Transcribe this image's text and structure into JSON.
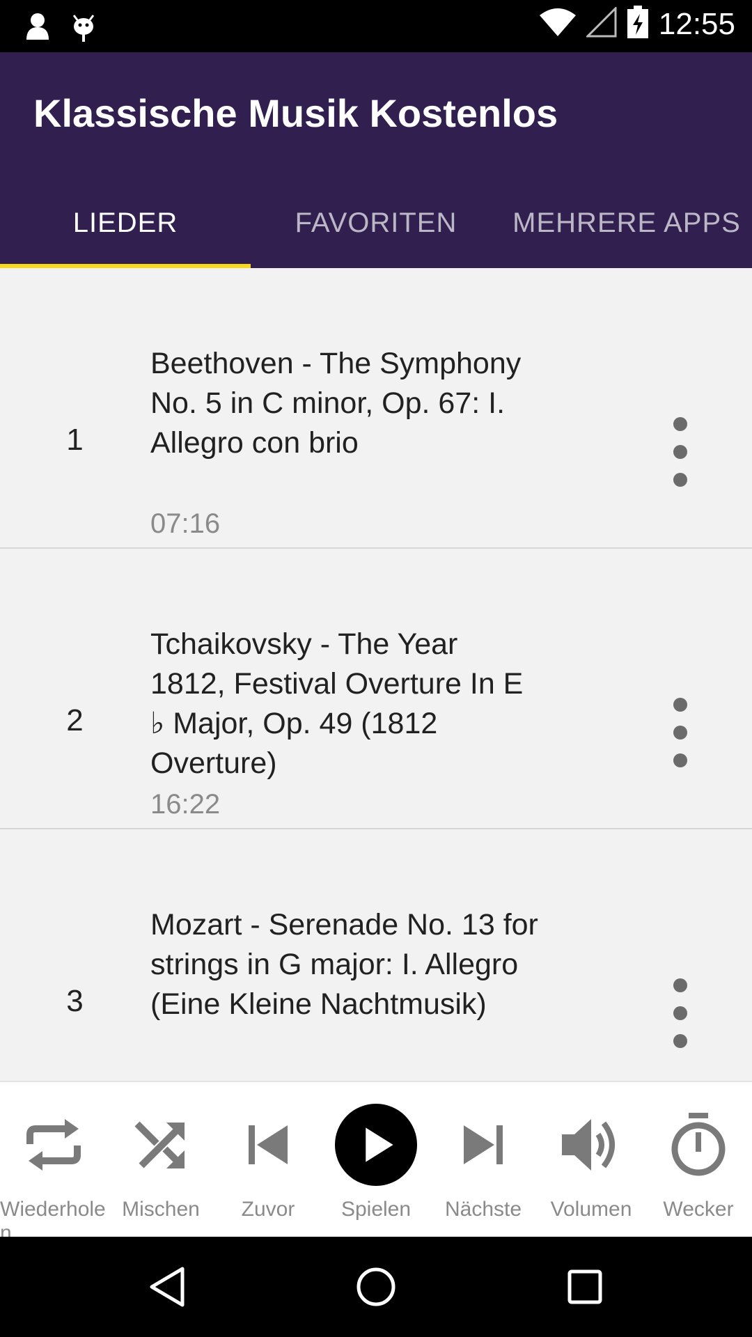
{
  "status_bar": {
    "time": "12:55",
    "icons": [
      "notification-person-icon",
      "android-debug-icon",
      "wifi-icon",
      "signal-icon",
      "battery-charging-icon"
    ]
  },
  "app": {
    "title": "Klassische Musik Kostenlos",
    "colors": {
      "appbar": "#31204F",
      "indicator": "#F8D81C",
      "list_bg": "#F2F2F2"
    }
  },
  "tabs": [
    {
      "label": "LIEDER",
      "active": true
    },
    {
      "label": "FAVORITEN",
      "active": false
    },
    {
      "label": "MEHRERE APPS",
      "active": false
    }
  ],
  "songs": [
    {
      "number": "1",
      "title": "Beethoven - The Symphony No. 5 in C minor, Op. 67: I. Allegro con brio",
      "duration": "07:16"
    },
    {
      "number": "2",
      "title": "Tchaikovsky - The Year 1812, Festival Overture In E ♭ Major, Op. 49 (1812 Overture)",
      "duration": "16:22"
    },
    {
      "number": "3",
      "title": "Mozart - Serenade No. 13 for strings in G major: I. Allegro (Eine Kleine Nachtmusik)",
      "duration": ""
    }
  ],
  "player": {
    "controls": [
      {
        "id": "repeat",
        "label": "Wiederholen",
        "icon": "repeat-icon"
      },
      {
        "id": "shuffle",
        "label": "Mischen",
        "icon": "shuffle-icon"
      },
      {
        "id": "previous",
        "label": "Zuvor",
        "icon": "skip-previous-icon"
      },
      {
        "id": "play",
        "label": "Spielen",
        "icon": "play-icon"
      },
      {
        "id": "next",
        "label": "Nächste",
        "icon": "skip-next-icon"
      },
      {
        "id": "volume",
        "label": "Volumen",
        "icon": "volume-icon"
      },
      {
        "id": "alarm",
        "label": "Wecker",
        "icon": "timer-icon"
      }
    ]
  },
  "nav": [
    "back-icon",
    "home-icon",
    "recents-icon"
  ]
}
